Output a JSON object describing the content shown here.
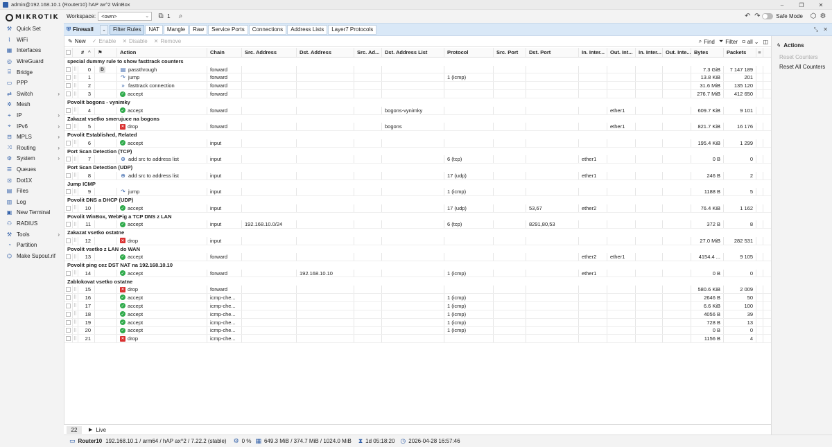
{
  "window": {
    "title": "admin@192.168.10.1 (Router10) hAP ax^2 WinBox",
    "controls": [
      "–",
      "❐",
      "✕"
    ]
  },
  "sidebar": {
    "logo": "MikroTik",
    "items": [
      {
        "label": "Quick Set",
        "icon": "quick-set-icon",
        "glyph": "⚒",
        "arrow": false
      },
      {
        "label": "WiFi",
        "icon": "wifi-icon",
        "glyph": "⌇",
        "arrow": false
      },
      {
        "label": "Interfaces",
        "icon": "interfaces-icon",
        "glyph": "▦",
        "arrow": false
      },
      {
        "label": "WireGuard",
        "icon": "wireguard-icon",
        "glyph": "◎",
        "arrow": false
      },
      {
        "label": "Bridge",
        "icon": "bridge-icon",
        "glyph": "⌸",
        "arrow": false
      },
      {
        "label": "PPP",
        "icon": "ppp-icon",
        "glyph": "▭",
        "arrow": false
      },
      {
        "label": "Switch",
        "icon": "switch-icon",
        "glyph": "⇄",
        "arrow": true
      },
      {
        "label": "Mesh",
        "icon": "mesh-icon",
        "glyph": "✲",
        "arrow": false
      },
      {
        "label": "IP",
        "icon": "ip-icon",
        "glyph": "⌖",
        "arrow": true
      },
      {
        "label": "IPv6",
        "icon": "ipv6-icon",
        "glyph": "⌖",
        "arrow": true
      },
      {
        "label": "MPLS",
        "icon": "mpls-icon",
        "glyph": "⊟",
        "arrow": true
      },
      {
        "label": "Routing",
        "icon": "routing-icon",
        "glyph": "⤨",
        "arrow": true
      },
      {
        "label": "System",
        "icon": "system-icon",
        "glyph": "⚙",
        "arrow": true
      },
      {
        "label": "Queues",
        "icon": "queues-icon",
        "glyph": "☰",
        "arrow": false
      },
      {
        "label": "Dot1X",
        "icon": "dot1x-icon",
        "glyph": "⊡",
        "arrow": false
      },
      {
        "label": "Files",
        "icon": "files-icon",
        "glyph": "▤",
        "arrow": false
      },
      {
        "label": "Log",
        "icon": "log-icon",
        "glyph": "▥",
        "arrow": false
      },
      {
        "label": "New Terminal",
        "icon": "terminal-icon",
        "glyph": "▣",
        "arrow": false
      },
      {
        "label": "RADIUS",
        "icon": "radius-icon",
        "glyph": "⚇",
        "arrow": false
      },
      {
        "label": "Tools",
        "icon": "tools-icon",
        "glyph": "⚒",
        "arrow": true
      },
      {
        "label": "Partition",
        "icon": "partition-icon",
        "glyph": "◔",
        "arrow": false
      },
      {
        "label": "Make Supout.rif",
        "icon": "supout-icon",
        "glyph": "⌬",
        "arrow": false
      }
    ]
  },
  "topbar": {
    "workspace_label": "Workspace:",
    "workspace_value": "<own>",
    "windows_count": "1",
    "safe_mode": "Safe Mode"
  },
  "tabs": {
    "section": "Firewall",
    "items": [
      "Filter Rules",
      "NAT",
      "Mangle",
      "Raw",
      "Service Ports",
      "Connections",
      "Address Lists",
      "Layer7 Protocols"
    ],
    "active": 0
  },
  "actionbar": {
    "new": "New",
    "enable": "Enable",
    "disable": "Disable",
    "remove": "Remove",
    "find": "Find",
    "filter": "Filter",
    "view": "all"
  },
  "table": {
    "headers": {
      "num": "#",
      "action": "Action",
      "chain": "Chain",
      "src": "Src. Address",
      "dst": "Dst. Address",
      "srcl": "Src. Ad...",
      "dstl": "Dst. Address List",
      "proto": "Protocol",
      "sport": "Src. Port",
      "dport": "Dst. Port",
      "inif": "In. Inter...",
      "outif": "Out. Int...",
      "inil": "In. Inter...",
      "outil": "Out. Inte...",
      "bytes": "Bytes",
      "pkts": "Packets"
    },
    "rows": [
      {
        "comment": "special dummy rule to show fasttrack counters",
        "num": "0",
        "flag": "D",
        "action": "passthrough",
        "kind": "pass",
        "chain": "forward",
        "src": "",
        "dst": "",
        "dstl": "",
        "proto": "",
        "dport": "",
        "inif": "",
        "outif": "",
        "bytes": "7.3 GiB",
        "pkts": "7 147 189"
      },
      {
        "comment": "",
        "num": "1",
        "flag": "",
        "action": "jump",
        "kind": "jump",
        "chain": "forward",
        "src": "",
        "dst": "",
        "dstl": "",
        "proto": "1 (icmp)",
        "dport": "",
        "inif": "",
        "outif": "",
        "bytes": "13.8 KiB",
        "pkts": "201"
      },
      {
        "comment": "",
        "num": "2",
        "flag": "",
        "action": "fasttrack connection",
        "kind": "fast",
        "chain": "forward",
        "src": "",
        "dst": "",
        "dstl": "",
        "proto": "",
        "dport": "",
        "inif": "",
        "outif": "",
        "bytes": "31.6 MiB",
        "pkts": "135 120"
      },
      {
        "comment": "",
        "num": "3",
        "flag": "",
        "action": "accept",
        "kind": "accept",
        "chain": "forward",
        "src": "",
        "dst": "",
        "dstl": "",
        "proto": "",
        "dport": "",
        "inif": "",
        "outif": "",
        "bytes": "276.7 MiB",
        "pkts": "412 650"
      },
      {
        "comment": "Povolit bogons - vynimky",
        "num": "4",
        "flag": "",
        "action": "accept",
        "kind": "accept",
        "chain": "forward",
        "src": "",
        "dst": "",
        "dstl": "bogons-vynimky",
        "proto": "",
        "dport": "",
        "inif": "",
        "outif": "ether1",
        "bytes": "609.7 KiB",
        "pkts": "9 101"
      },
      {
        "comment": "Zakazat vsetko smerujuce na bogons",
        "num": "5",
        "flag": "",
        "action": "drop",
        "kind": "drop",
        "chain": "forward",
        "src": "",
        "dst": "",
        "dstl": "bogons",
        "proto": "",
        "dport": "",
        "inif": "",
        "outif": "ether1",
        "bytes": "821.7 KiB",
        "pkts": "16 176"
      },
      {
        "comment": "Povolit Established, Related",
        "num": "6",
        "flag": "",
        "action": "accept",
        "kind": "accept",
        "chain": "input",
        "src": "",
        "dst": "",
        "dstl": "",
        "proto": "",
        "dport": "",
        "inif": "",
        "outif": "",
        "bytes": "195.4 KiB",
        "pkts": "1 299"
      },
      {
        "comment": "Port Scan Detection (TCP)",
        "num": "7",
        "flag": "",
        "action": "add src to address list",
        "kind": "addlist",
        "chain": "input",
        "src": "",
        "dst": "",
        "dstl": "",
        "proto": "6 (tcp)",
        "dport": "",
        "inif": "ether1",
        "outif": "",
        "bytes": "0 B",
        "pkts": "0"
      },
      {
        "comment": "Port Scan Detection (UDP)",
        "num": "8",
        "flag": "",
        "action": "add src to address list",
        "kind": "addlist",
        "chain": "input",
        "src": "",
        "dst": "",
        "dstl": "",
        "proto": "17 (udp)",
        "dport": "",
        "inif": "ether1",
        "outif": "",
        "bytes": "246 B",
        "pkts": "2"
      },
      {
        "comment": "Jump ICMP",
        "num": "9",
        "flag": "",
        "action": "jump",
        "kind": "jump",
        "chain": "input",
        "src": "",
        "dst": "",
        "dstl": "",
        "proto": "1 (icmp)",
        "dport": "",
        "inif": "",
        "outif": "",
        "bytes": "1188 B",
        "pkts": "5"
      },
      {
        "comment": "Povolit DNS a DHCP (UDP)",
        "num": "10",
        "flag": "",
        "action": "accept",
        "kind": "accept",
        "chain": "input",
        "src": "",
        "dst": "",
        "dstl": "",
        "proto": "17 (udp)",
        "dport": "53,67",
        "inif": "ether2",
        "outif": "",
        "bytes": "76.4 KiB",
        "pkts": "1 162"
      },
      {
        "comment": "Povolit WinBox, WebFig a TCP DNS z LAN",
        "num": "11",
        "flag": "",
        "action": "accept",
        "kind": "accept",
        "chain": "input",
        "src": "192.168.10.0/24",
        "dst": "",
        "dstl": "",
        "proto": "6 (tcp)",
        "dport": "8291,80,53",
        "inif": "",
        "outif": "",
        "bytes": "372 B",
        "pkts": "8"
      },
      {
        "comment": "Zakazat vsetko ostatne",
        "num": "12",
        "flag": "",
        "action": "drop",
        "kind": "drop",
        "chain": "input",
        "src": "",
        "dst": "",
        "dstl": "",
        "proto": "",
        "dport": "",
        "inif": "",
        "outif": "",
        "bytes": "27.0 MiB",
        "pkts": "282 531"
      },
      {
        "comment": "Povolit vsetko z LAN do WAN",
        "num": "13",
        "flag": "",
        "action": "accept",
        "kind": "accept",
        "chain": "forward",
        "src": "",
        "dst": "",
        "dstl": "",
        "proto": "",
        "dport": "",
        "inif": "ether2",
        "outif": "ether1",
        "bytes": "4154.4 ...",
        "pkts": "9 105"
      },
      {
        "comment": "Povolit ping cez DST NAT na 192.168.10.10",
        "num": "14",
        "flag": "",
        "action": "accept",
        "kind": "accept",
        "chain": "forward",
        "src": "",
        "dst": "192.168.10.10",
        "dstl": "",
        "proto": "1 (icmp)",
        "dport": "",
        "inif": "ether1",
        "outif": "",
        "bytes": "0 B",
        "pkts": "0"
      },
      {
        "comment": "Zablokovat vsetko ostatne",
        "num": "15",
        "flag": "",
        "action": "drop",
        "kind": "drop",
        "chain": "forward",
        "src": "",
        "dst": "",
        "dstl": "",
        "proto": "",
        "dport": "",
        "inif": "",
        "outif": "",
        "bytes": "580.6 KiB",
        "pkts": "2 009"
      },
      {
        "comment": "",
        "num": "16",
        "flag": "",
        "action": "accept",
        "kind": "accept",
        "chain": "icmp-che...",
        "src": "",
        "dst": "",
        "dstl": "",
        "proto": "1 (icmp)",
        "dport": "",
        "inif": "",
        "outif": "",
        "bytes": "2646 B",
        "pkts": "50"
      },
      {
        "comment": "",
        "num": "17",
        "flag": "",
        "action": "accept",
        "kind": "accept",
        "chain": "icmp-che...",
        "src": "",
        "dst": "",
        "dstl": "",
        "proto": "1 (icmp)",
        "dport": "",
        "inif": "",
        "outif": "",
        "bytes": "6.6 KiB",
        "pkts": "100"
      },
      {
        "comment": "",
        "num": "18",
        "flag": "",
        "action": "accept",
        "kind": "accept",
        "chain": "icmp-che...",
        "src": "",
        "dst": "",
        "dstl": "",
        "proto": "1 (icmp)",
        "dport": "",
        "inif": "",
        "outif": "",
        "bytes": "4056 B",
        "pkts": "39"
      },
      {
        "comment": "",
        "num": "19",
        "flag": "",
        "action": "accept",
        "kind": "accept",
        "chain": "icmp-che...",
        "src": "",
        "dst": "",
        "dstl": "",
        "proto": "1 (icmp)",
        "dport": "",
        "inif": "",
        "outif": "",
        "bytes": "728 B",
        "pkts": "13"
      },
      {
        "comment": "",
        "num": "20",
        "flag": "",
        "action": "accept",
        "kind": "accept",
        "chain": "icmp-che...",
        "src": "",
        "dst": "",
        "dstl": "",
        "proto": "1 (icmp)",
        "dport": "",
        "inif": "",
        "outif": "",
        "bytes": "0 B",
        "pkts": "0"
      },
      {
        "comment": "",
        "num": "21",
        "flag": "",
        "action": "drop",
        "kind": "drop",
        "chain": "icmp-che...",
        "src": "",
        "dst": "",
        "dstl": "",
        "proto": "",
        "dport": "",
        "inif": "",
        "outif": "",
        "bytes": "1156 B",
        "pkts": "4"
      }
    ]
  },
  "footer": {
    "count": "22",
    "live": "Live"
  },
  "actions_pane": {
    "title": "Actions",
    "reset_counters": "Reset Counters",
    "reset_all_counters": "Reset All Counters"
  },
  "status": {
    "router": "Router10",
    "info": "192.168.10.1 / arm64 / hAP ax^2 / 7.22.2 (stable)",
    "cpu": "0 %",
    "memory": "649.3 MiB / 374.7 MiB / 1024.0 MiB",
    "uptime": "1d 05:18:20",
    "datetime": "2026-04-28 16:57:46"
  },
  "colors": {
    "accent": "#2f5ea8",
    "accept": "#2eaa4a",
    "drop": "#d93030",
    "tab_bar": "#d9e8f7"
  }
}
